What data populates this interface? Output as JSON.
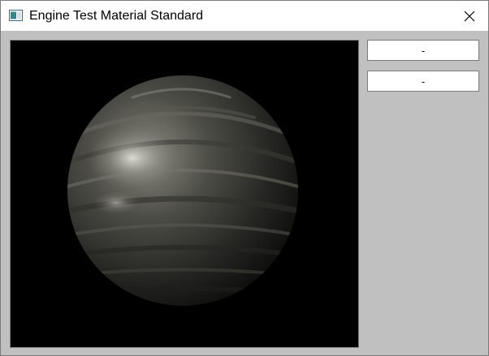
{
  "window": {
    "title": "Engine Test Material Standard"
  },
  "icons": {
    "app": "app-window-icon",
    "close": "close-icon"
  },
  "sidebar": {
    "buttons": [
      {
        "label": "-"
      },
      {
        "label": "-"
      }
    ]
  },
  "viewport": {
    "background": "#000000",
    "object": "sphere"
  }
}
